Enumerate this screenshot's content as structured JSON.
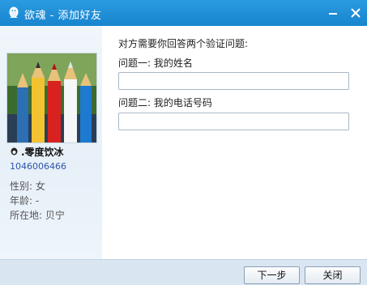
{
  "window": {
    "title": "欲魂 - 添加好友",
    "minimize_label": "—",
    "close_label": "✕",
    "accent_color": "#1f8fd6"
  },
  "sidebar": {
    "nickname": ".零度饮冰",
    "qq_number": "1046006466",
    "gender": "性别: 女",
    "age": "年龄: -",
    "location": "所在地: 贝宁"
  },
  "main": {
    "prompt": "对方需要你回答两个验证问题:",
    "question1_label": "问题一: 我的姓名",
    "question1_value": "",
    "question2_label": "问题二: 我的电话号码",
    "question2_value": ""
  },
  "footer": {
    "next_label": "下一步",
    "close_label": "关闭"
  }
}
